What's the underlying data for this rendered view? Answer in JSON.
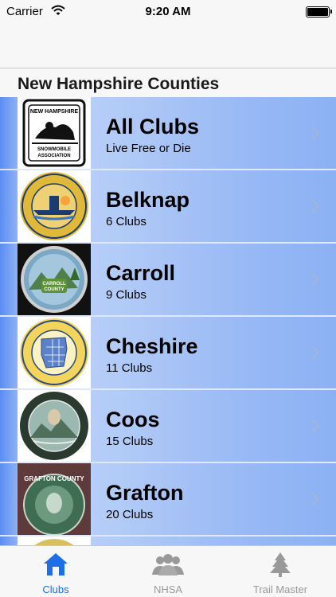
{
  "status_bar": {
    "carrier": "Carrier",
    "time": "9:20 AM"
  },
  "section_header": "New Hampshire Counties",
  "counties": [
    {
      "name": "All Clubs",
      "subtitle": "Live Free or Die",
      "seal_icon": "snowmobile-association-logo"
    },
    {
      "name": "Belknap",
      "subtitle": "6 Clubs",
      "seal_icon": "belknap-county-seal"
    },
    {
      "name": "Carroll",
      "subtitle": "9 Clubs",
      "seal_icon": "carroll-county-seal"
    },
    {
      "name": "Cheshire",
      "subtitle": "11 Clubs",
      "seal_icon": "cheshire-county-seal"
    },
    {
      "name": "Coos",
      "subtitle": "15 Clubs",
      "seal_icon": "coos-county-seal"
    },
    {
      "name": "Grafton",
      "subtitle": "20 Clubs",
      "seal_icon": "grafton-county-seal"
    }
  ],
  "tabs": [
    {
      "label": "Clubs",
      "icon": "home-icon",
      "active": true
    },
    {
      "label": "NHSA",
      "icon": "people-icon",
      "active": false
    },
    {
      "label": "Trail Master",
      "icon": "tree-icon",
      "active": false
    }
  ],
  "colors": {
    "accent": "#1c6fe8",
    "row_gradient_start": "#c4d7fb",
    "row_gradient_end": "#8cb1f3"
  }
}
